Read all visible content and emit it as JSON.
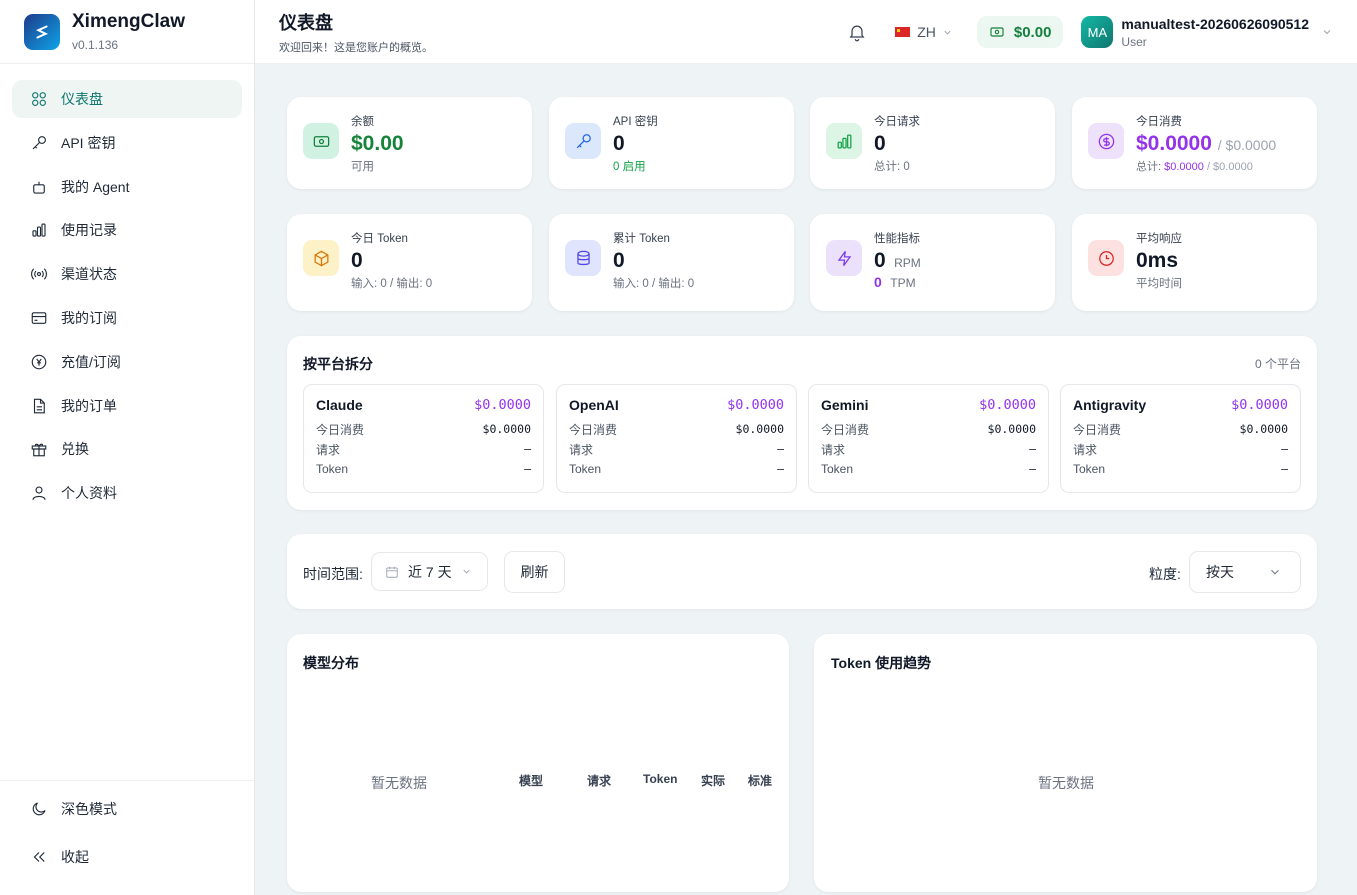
{
  "app": {
    "name": "XimengClaw",
    "version": "v0.1.136"
  },
  "sidebar": {
    "items": [
      {
        "label": "仪表盘",
        "icon": "dashboard-icon"
      },
      {
        "label": "API 密钥",
        "icon": "key-icon"
      },
      {
        "label": "我的 Agent",
        "icon": "bot-icon"
      },
      {
        "label": "使用记录",
        "icon": "bar-chart-icon"
      },
      {
        "label": "渠道状态",
        "icon": "signal-icon"
      },
      {
        "label": "我的订阅",
        "icon": "credit-card-icon"
      },
      {
        "label": "充值/订阅",
        "icon": "yuan-icon"
      },
      {
        "label": "我的订单",
        "icon": "document-icon"
      },
      {
        "label": "兑换",
        "icon": "gift-icon"
      },
      {
        "label": "个人资料",
        "icon": "user-icon"
      }
    ],
    "dark_mode": "深色模式",
    "collapse": "收起"
  },
  "header": {
    "title": "仪表盘",
    "subtitle": "欢迎回来！这是您账户的概览。",
    "lang": "ZH",
    "balance": "$0.00",
    "avatar": "MA",
    "username": "manualtest-20260626090512",
    "role": "User"
  },
  "stats": {
    "balance": {
      "label": "余额",
      "value": "$0.00",
      "sub": "可用"
    },
    "api_keys": {
      "label": "API 密钥",
      "value": "0",
      "sub": "0 启用"
    },
    "today_requests": {
      "label": "今日请求",
      "value": "0",
      "sub": "总计: 0"
    },
    "today_cost": {
      "label": "今日消费",
      "value": "$0.0000",
      "value2": "/ $0.0000",
      "sub_prefix": "总计: ",
      "sub_a": "$0.0000",
      "sub_b": " / $0.0000"
    },
    "today_token": {
      "label": "今日 Token",
      "value": "0",
      "sub": "输入: 0 / 输出: 0"
    },
    "total_token": {
      "label": "累计 Token",
      "value": "0",
      "sub": "输入: 0 / 输出: 0"
    },
    "perf": {
      "label": "性能指标",
      "rpm_value": "0",
      "rpm_unit": "RPM",
      "tpm_value": "0",
      "tpm_unit": "TPM"
    },
    "avg_resp": {
      "label": "平均响应",
      "value": "0ms",
      "sub": "平均时间"
    }
  },
  "platforms": {
    "title": "按平台拆分",
    "count": "0 个平台",
    "row_labels": {
      "cost": "今日消费",
      "requests": "请求",
      "token": "Token"
    },
    "items": [
      {
        "name": "Claude",
        "cost": "$0.0000",
        "today": "$0.0000",
        "requests": "–",
        "token": "–"
      },
      {
        "name": "OpenAI",
        "cost": "$0.0000",
        "today": "$0.0000",
        "requests": "–",
        "token": "–"
      },
      {
        "name": "Gemini",
        "cost": "$0.0000",
        "today": "$0.0000",
        "requests": "–",
        "token": "–"
      },
      {
        "name": "Antigravity",
        "cost": "$0.0000",
        "today": "$0.0000",
        "requests": "–",
        "token": "–"
      }
    ]
  },
  "filters": {
    "range_label": "时间范围:",
    "range_value": "近 7 天",
    "refresh": "刷新",
    "granularity_label": "粒度:",
    "granularity_value": "按天"
  },
  "model_dist": {
    "title": "模型分布",
    "empty": "暂无数据",
    "columns": [
      "模型",
      "请求",
      "Token",
      "实际",
      "标准"
    ]
  },
  "token_trend": {
    "title": "Token 使用趋势",
    "empty": "暂无数据"
  }
}
